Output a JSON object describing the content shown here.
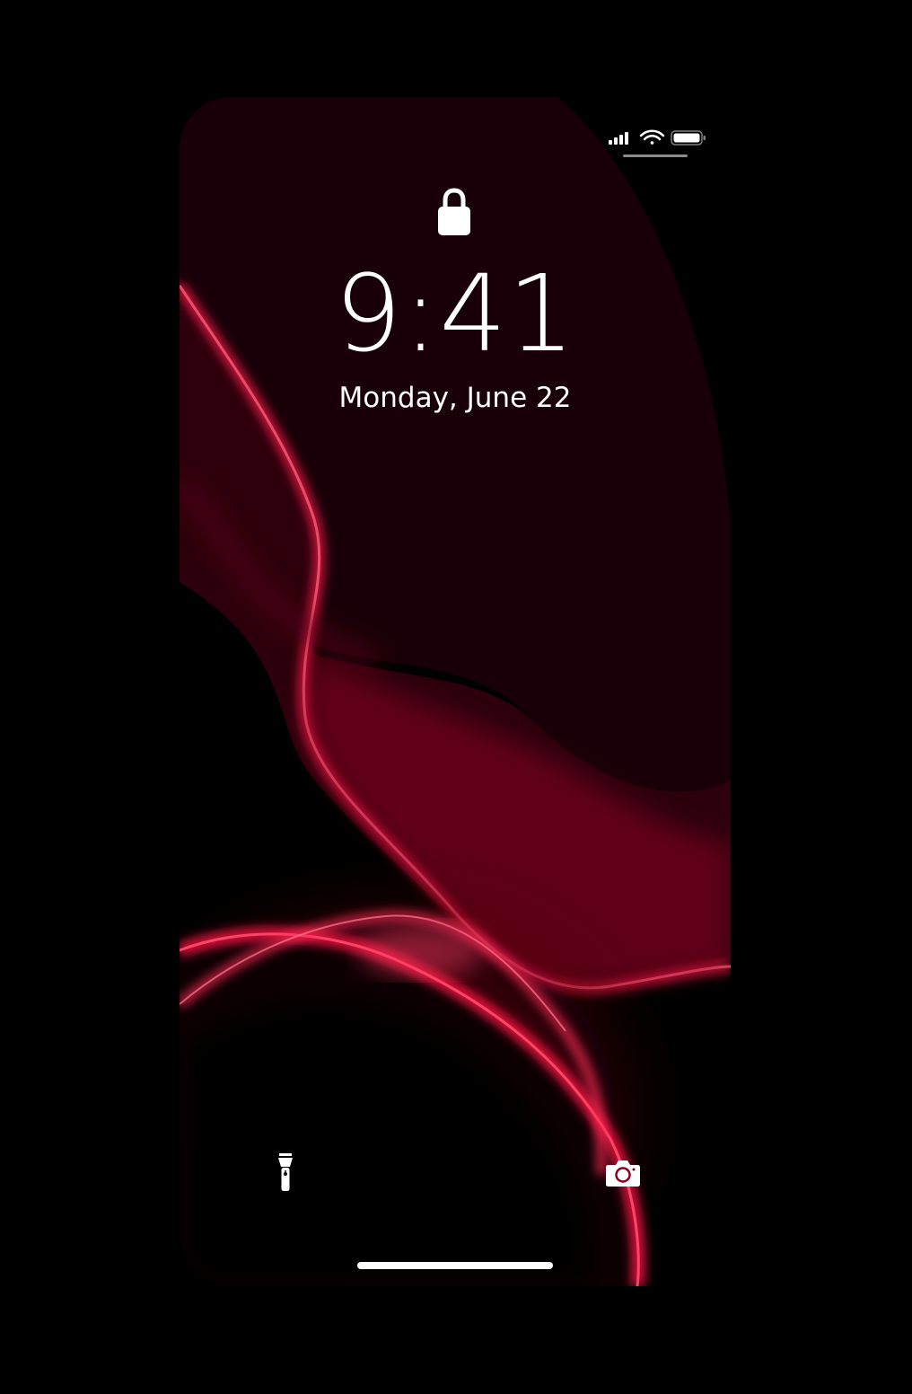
{
  "lock_screen": {
    "time": "9:41",
    "date": "Monday, June 22"
  },
  "status_bar": {
    "icons": [
      "cellular-signal-icon",
      "wifi-icon",
      "battery-icon"
    ]
  },
  "quick_actions": {
    "left_icon": "flashlight-icon",
    "right_icon": "camera-icon"
  },
  "colors": {
    "background": "#000000",
    "wallpaper_accent": "#ff1744",
    "text": "#ffffff"
  }
}
